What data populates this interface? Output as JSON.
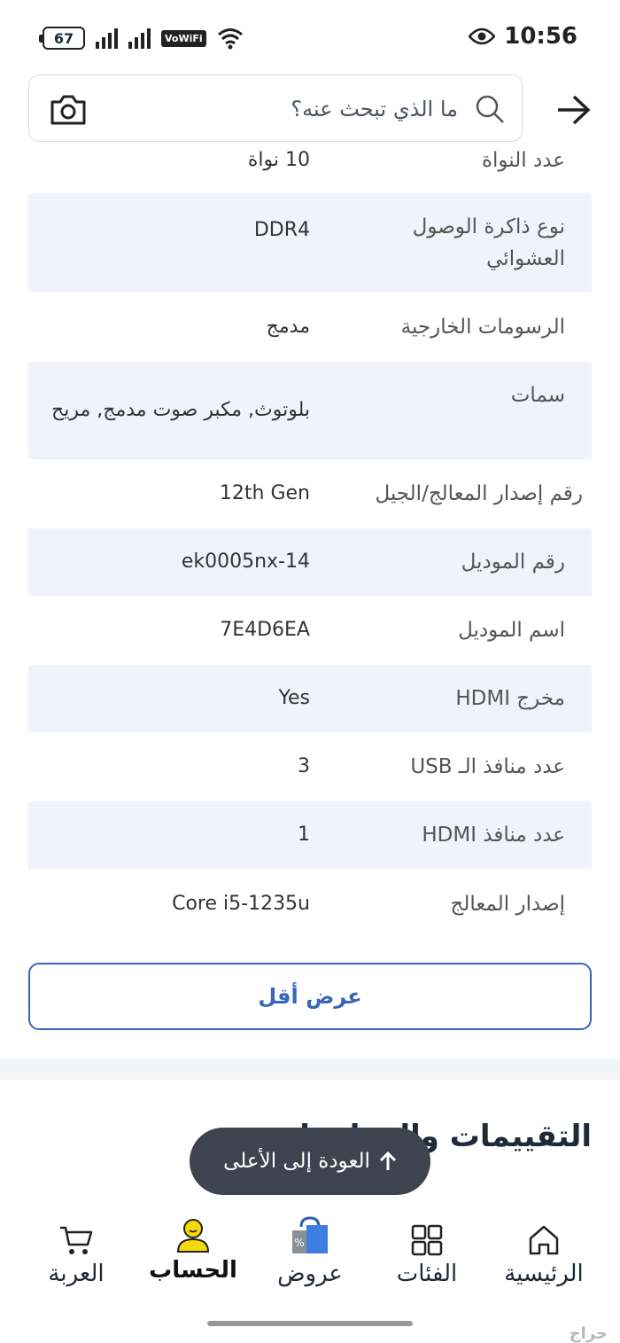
{
  "status_bar": {
    "battery": "67",
    "vowifi": "VoWiFi",
    "time": "10:56"
  },
  "search": {
    "placeholder": "ما الذي تبحث عنه؟"
  },
  "specs": [
    {
      "label": "عدد النواة",
      "value": "10 نواة"
    },
    {
      "label": "نوع ذاكرة الوصول العشوائي",
      "value": "DDR4"
    },
    {
      "label": "الرسومات الخارجية",
      "value": "مدمج"
    },
    {
      "label": "سمات",
      "value": "بلوتوث, مكبر صوت مدمج, مريح"
    },
    {
      "label": "رقم إصدار المعالج/الجيل",
      "value": "12th Gen"
    },
    {
      "label": "رقم الموديل",
      "value": "14-ek0005nx"
    },
    {
      "label": "اسم الموديل",
      "value": "7E4D6EA"
    },
    {
      "label": "مخرج HDMI",
      "value": "Yes"
    },
    {
      "label": "عدد منافذ الـ USB",
      "value": "3"
    },
    {
      "label": "عدد منافذ HDMI",
      "value": "1"
    },
    {
      "label": "إصدار المعالج",
      "value": "Core i5-1235u"
    }
  ],
  "show_less_label": "عرض أقل",
  "ratings_title": "التقييمات والمراجعات",
  "back_to_top_label": "العودة إلى الأعلى",
  "bottom_nav": {
    "home": "الرئيسية",
    "categories": "الفئات",
    "offers": "عروض",
    "account": "الحساب",
    "cart": "العربة"
  },
  "watermark": "حراج",
  "colors": {
    "accent": "#3866b8",
    "row_alt": "#f0f3fb",
    "toast": "#3d4450",
    "avatar_yellow": "#f5d90a"
  }
}
